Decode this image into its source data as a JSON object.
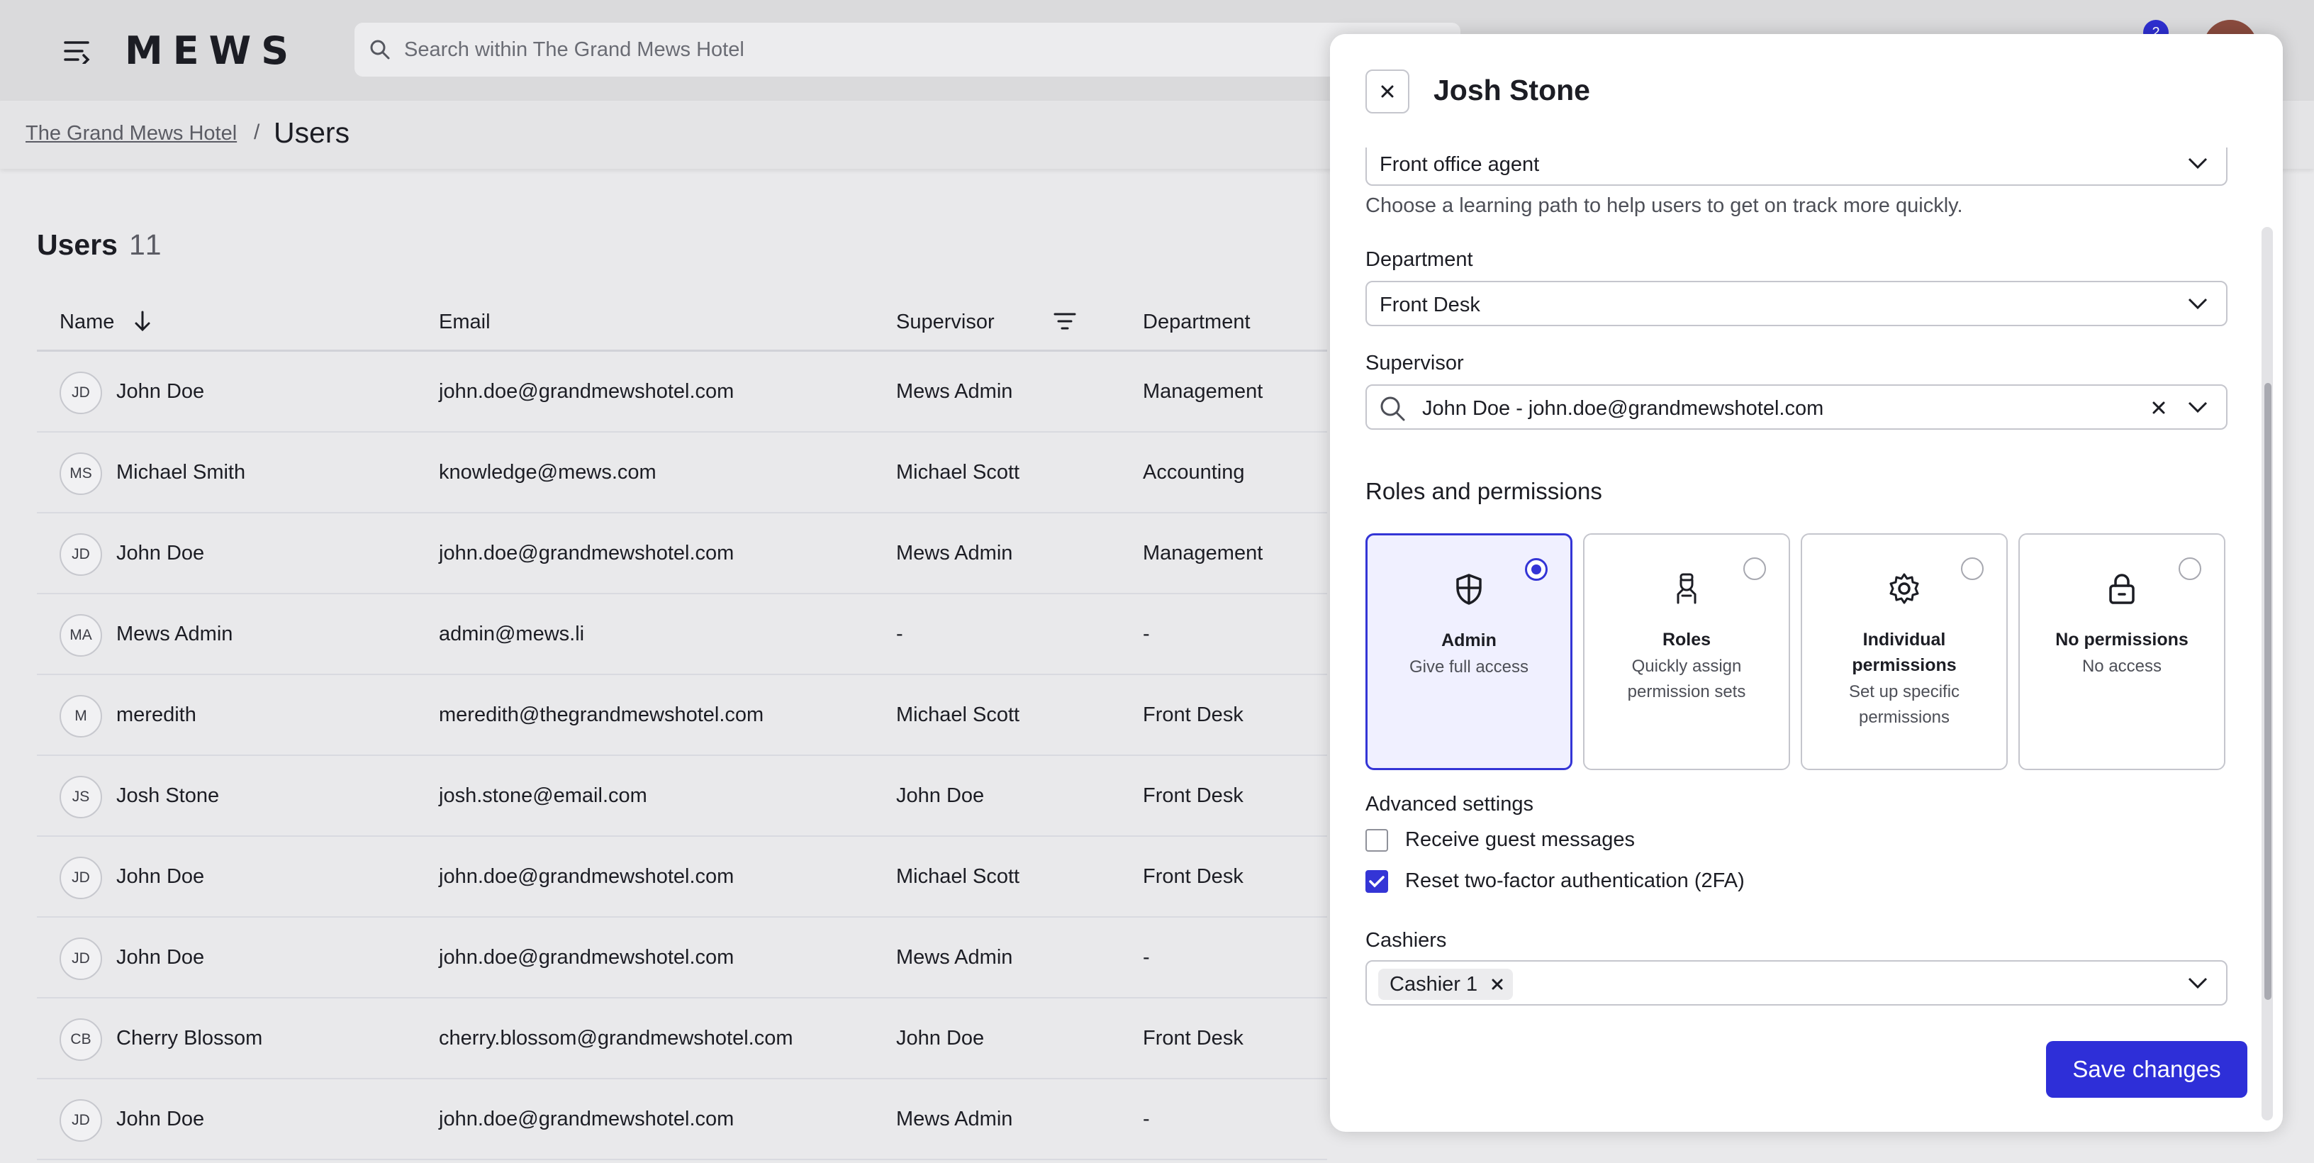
{
  "topbar": {
    "logo": "MEWS",
    "search_placeholder": "Search within The Grand Mews Hotel",
    "notification_count": "2"
  },
  "breadcrumb": {
    "parent": "The Grand Mews Hotel",
    "separator": "/",
    "current": "Users"
  },
  "users": {
    "heading": "Users",
    "count": "11",
    "columns": {
      "name": "Name",
      "email": "Email",
      "supervisor": "Supervisor",
      "department": "Department"
    },
    "rows": [
      {
        "initials": "JD",
        "name": "John Doe",
        "email": "john.doe@grandmewshotel.com",
        "supervisor": "Mews Admin",
        "department": "Management"
      },
      {
        "initials": "MS",
        "name": "Michael Smith",
        "email": "knowledge@mews.com",
        "supervisor": "Michael Scott",
        "department": "Accounting"
      },
      {
        "initials": "JD",
        "name": "John Doe",
        "email": "john.doe@grandmewshotel.com",
        "supervisor": "Mews Admin",
        "department": "Management"
      },
      {
        "initials": "MA",
        "name": "Mews Admin",
        "email": "admin@mews.li",
        "supervisor": "-",
        "department": "-"
      },
      {
        "initials": "M",
        "name": "meredith",
        "email": "meredith@thegrandmewshotel.com",
        "supervisor": "Michael Scott",
        "department": "Front Desk"
      },
      {
        "initials": "JS",
        "name": "Josh Stone",
        "email": "josh.stone@email.com",
        "supervisor": "John Doe",
        "department": "Front Desk"
      },
      {
        "initials": "JD",
        "name": "John Doe",
        "email": "john.doe@grandmewshotel.com",
        "supervisor": "Michael Scott",
        "department": "Front Desk"
      },
      {
        "initials": "JD",
        "name": "John Doe",
        "email": "john.doe@grandmewshotel.com",
        "supervisor": "Mews Admin",
        "department": "-"
      },
      {
        "initials": "CB",
        "name": "Cherry Blossom",
        "email": "cherry.blossom@grandmewshotel.com",
        "supervisor": "John Doe",
        "department": "Front Desk"
      },
      {
        "initials": "JD",
        "name": "John Doe",
        "email": "john.doe@grandmewshotel.com",
        "supervisor": "Mews Admin",
        "department": "-"
      }
    ]
  },
  "panel": {
    "title": "Josh Stone",
    "learning_path_value": "Front office agent",
    "learning_path_helper": "Choose a learning path to help users to get on track more quickly.",
    "department_label": "Department",
    "department_value": "Front Desk",
    "supervisor_label": "Supervisor",
    "supervisor_value": "John Doe - john.doe@grandmewshotel.com",
    "roles_title": "Roles and permissions",
    "roles": [
      {
        "title": "Admin",
        "desc": "Give full access",
        "selected": true,
        "icon": "shield-icon"
      },
      {
        "title": "Roles",
        "desc": "Quickly assign permission sets",
        "selected": false,
        "icon": "person-icon"
      },
      {
        "title": "Individual permissions",
        "desc": "Set up specific permissions",
        "selected": false,
        "icon": "gear-icon"
      },
      {
        "title": "No permissions",
        "desc": "No access",
        "selected": false,
        "icon": "lock-icon"
      }
    ],
    "advanced_title": "Advanced settings",
    "receive_guest_messages": "Receive guest messages",
    "reset_2fa": "Reset two-factor authentication (2FA)",
    "cashiers_label": "Cashiers",
    "cashier_chip": "Cashier 1",
    "save_label": "Save changes"
  },
  "colors": {
    "accent": "#2e2fd8",
    "selected_card_bg": "#f0f0ff",
    "topbar_bg": "#dadadc"
  }
}
